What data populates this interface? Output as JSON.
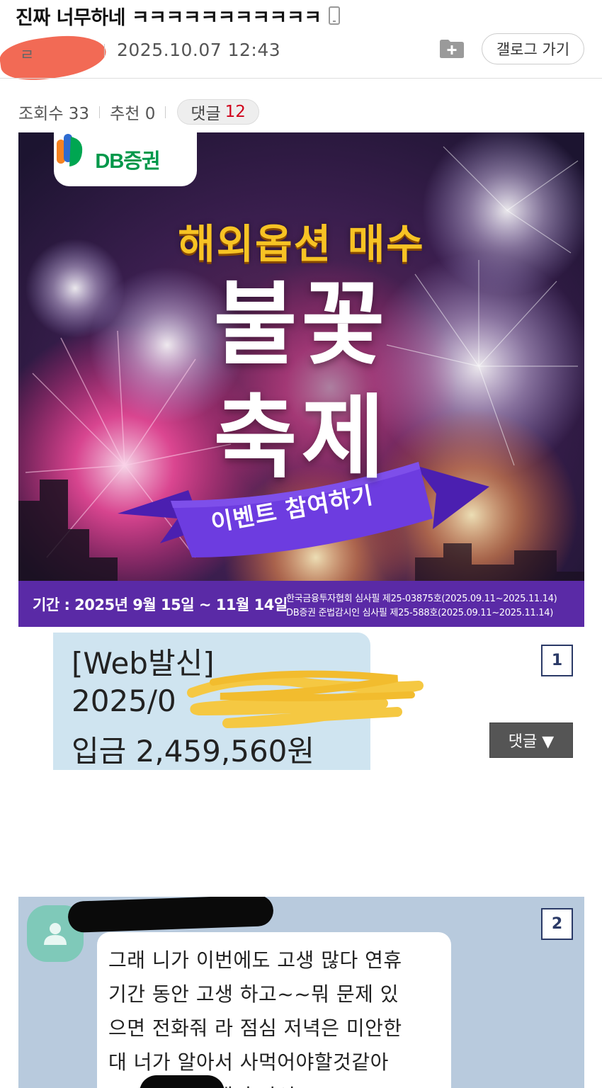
{
  "post": {
    "title": "진짜 너무하네 ㅋㅋㅋㅋㅋㅋㅋㅋㅋㅋㅋ",
    "author_visible": "ㄹ",
    "date": "2025.10.07 12:43",
    "gallog_label": "갤로그 가기",
    "views_label": "조회수 33",
    "recommend_label": "추천 0",
    "comments_label": "댓글",
    "comments_count": "12"
  },
  "banner": {
    "logo_text": "DB증권",
    "headline_small": "해외옵션 매수",
    "headline_big_1": "불꽃",
    "headline_big_2": "축제",
    "ribbon_text": "이벤트 참여하기",
    "period": "기간 : 2025년 9월 15일 ~ 11월 14일",
    "review_1": "한국금융투자협회 심사필 제25-03875호(2025.09.11~2025.11.14)",
    "review_2": "DB증권 준법감시인 심사필 제25-588호(2025.09.11~2025.11.14)"
  },
  "image1": {
    "line1": "[Web발신]",
    "line2": "2025/0",
    "line3": "입금 2,459,560원",
    "badge": "1",
    "comment_toggle": "댓글 ▼"
  },
  "image2": {
    "badge": "2",
    "lines": [
      "그래 니가 이번에도 고생 많다 연휴",
      "기간 동안 고생 하고~~뭐 문제 있",
      "으면 전화줘 라  점심 저녁은 미안한",
      "대 너가 알아서 사먹어야할것같아",
      "                도 여역은 아해서 마이"
    ]
  },
  "colors": {
    "comment_count": "#d0021b",
    "banner_footer": "#5a2aa6",
    "badge": "#2b3a67",
    "sms_bubble": "#cfe4f0",
    "chat_background": "#b8cadd"
  }
}
